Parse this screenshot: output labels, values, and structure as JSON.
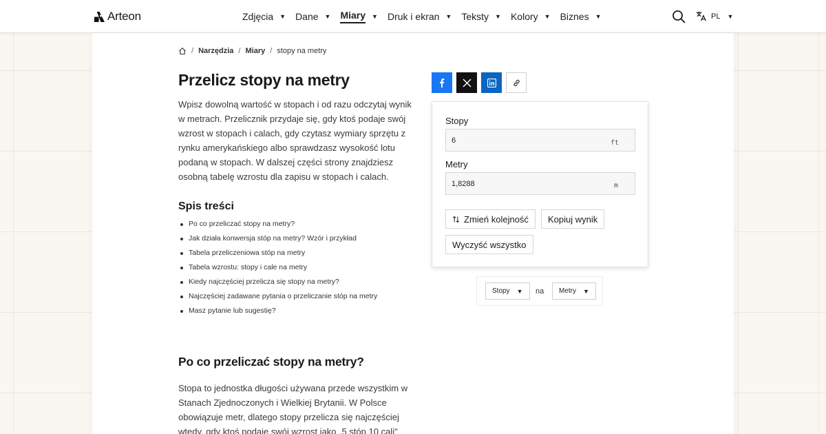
{
  "header": {
    "logo_text": "Arteon",
    "nav": [
      {
        "label": "Zdjęcia",
        "active": false
      },
      {
        "label": "Dane",
        "active": false
      },
      {
        "label": "Miary",
        "active": true
      },
      {
        "label": "Druk i ekran",
        "active": false
      },
      {
        "label": "Teksty",
        "active": false
      },
      {
        "label": "Kolory",
        "active": false
      },
      {
        "label": "Biznes",
        "active": false
      }
    ],
    "caret": "▼",
    "search_icon": "search-icon",
    "language": {
      "icon": "translate-icon",
      "code": "PL"
    }
  },
  "breadcrumb": {
    "home_icon": "home-icon",
    "separator": "/",
    "items": [
      "Narzędzia",
      "Miary",
      "stopy na metry"
    ]
  },
  "page": {
    "title": "Przelicz stopy na metry",
    "intro": "Wpisz dowolną wartość w stopach i od razu odczytaj wynik w metrach. Przelicznik przydaje się, gdy ktoś podaje swój wzrost w stopach i calach, gdy czytasz wymiary sprzętu z rynku amerykańskiego albo sprawdzasz wysokość lotu podaną w stopach. W dalszej części strony znajdziesz osobną tabelę wzrostu dla zapisu w stopach i calach.",
    "toc_title": "Spis treści",
    "toc": [
      "Po co przeliczać stopy na metry?",
      "Jak działa konwersja stóp na metry? Wzór i przykład",
      "Tabela przeliczeniowa stóp na metry",
      "Tabela wzrostu: stopy i cale na metry",
      "Kiedy najczęściej przelicza się stopy na metry?",
      "Najczęściej zadawane pytania o przeliczanie stóp na metry",
      "Masz pytanie lub sugestię?"
    ],
    "section_title": "Po co przeliczać stopy na metry?",
    "section_text": "Stopa to jednostka długości używana przede wszystkim w Stanach Zjednoczonych i Wielkiej Brytanii. W Polsce obowiązuje metr, dlatego stopy przelicza się najczęściej wtedy, gdy ktoś podaje swój wzrost jako „5 stóp 10 cali\""
  },
  "share": {
    "icons": [
      "facebook-icon",
      "x-icon",
      "linkedin-icon",
      "link-icon"
    ],
    "colors": {
      "facebook": "#1877f2",
      "x": "#111111",
      "linkedin": "#0a66c2"
    }
  },
  "converter": {
    "from_label": "Stopy",
    "from_value": "6",
    "from_unit": "ft",
    "to_label": "Metry",
    "to_value": "1,8288",
    "to_unit": "m",
    "swap_label": "Zmień kolejność",
    "copy_label": "Kopiuj wynik",
    "clear_label": "Wyczyść wszystko"
  },
  "selector": {
    "from": "Stopy",
    "connector": "na",
    "to": "Metry"
  }
}
